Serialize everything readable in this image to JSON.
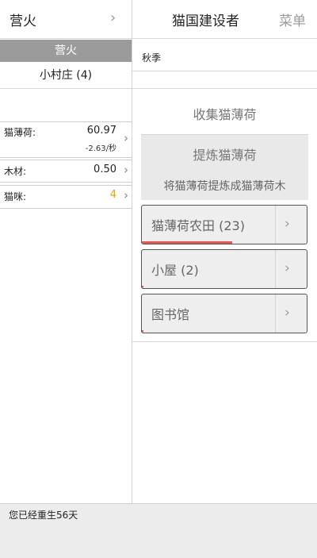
{
  "left": {
    "title": "营火",
    "section": "营火",
    "village": "小村庄 (4)",
    "resources": [
      {
        "name": "猫薄荷:",
        "value": "60.97",
        "rate": "-2.63/秒"
      },
      {
        "name": "木材:",
        "value": "0.50",
        "rate": ""
      },
      {
        "name": "猫咪:",
        "value": "4",
        "rate": ""
      }
    ]
  },
  "header": {
    "title": "猫国建设者",
    "menu": "菜单"
  },
  "main": {
    "season": "秋季",
    "gather_label": "收集猫薄荷",
    "refine_title": "提炼猫薄荷",
    "refine_desc": "将猫薄荷提炼成猫薄荷木",
    "buildings": [
      {
        "label": "猫薄荷农田 (23)",
        "progress": 0.55
      },
      {
        "label": "小屋 (2)",
        "progress": 0.01
      },
      {
        "label": "图书馆",
        "progress": 0.01
      }
    ]
  },
  "log": {
    "message": "您已经重生56天"
  },
  "colors": {
    "section_bar": "#9b9b9b",
    "kittens_value": "#e8a300",
    "progress": "#e05a5a"
  },
  "icons": {
    "chevron": "chevron-right-icon"
  }
}
